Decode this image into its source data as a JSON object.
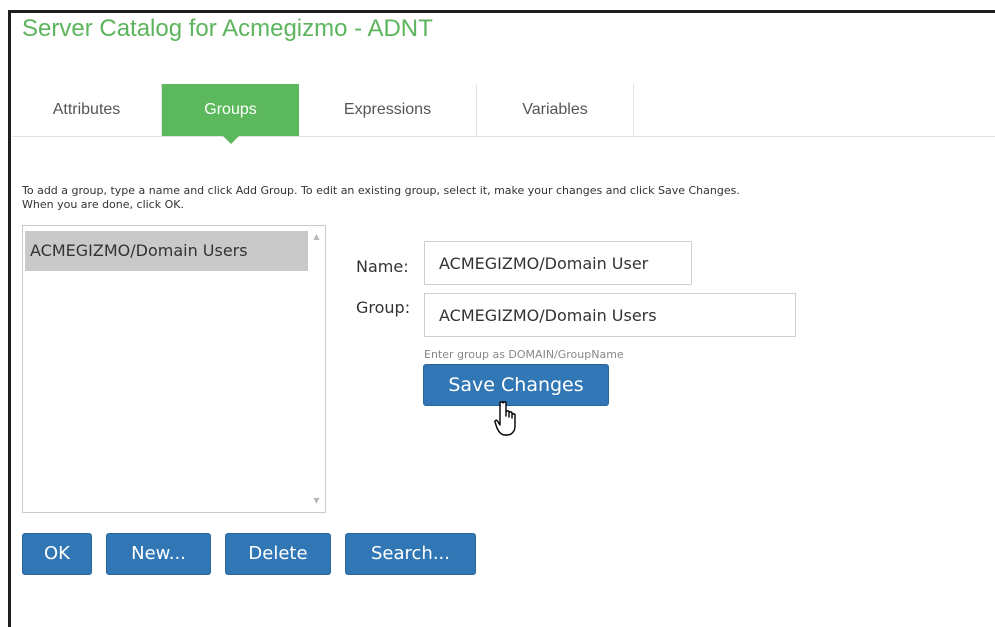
{
  "window": {
    "title": "Server Catalog for Acmegizmo - ADNT"
  },
  "tabs": [
    {
      "label": "Attributes",
      "active": false
    },
    {
      "label": "Groups",
      "active": true
    },
    {
      "label": "Expressions",
      "active": false
    },
    {
      "label": "Variables",
      "active": false
    }
  ],
  "instructions": {
    "line1": "To add a group, type a name and click Add Group. To edit an existing group, select it, make your changes and click Save Changes.",
    "line2": "When you are done, click OK."
  },
  "group_list": {
    "items": [
      {
        "label": "ACMEGIZMO/Domain Users",
        "selected": true
      }
    ]
  },
  "form": {
    "name_label": "Name:",
    "name_value": "ACMEGIZMO/Domain User",
    "group_label": "Group:",
    "group_value": "ACMEGIZMO/Domain Users",
    "group_help": "Enter group as DOMAIN/GroupName",
    "save_label": "Save Changes"
  },
  "actions": {
    "ok_label": "OK",
    "new_label": "New...",
    "delete_label": "Delete",
    "search_label": "Search..."
  },
  "colors": {
    "title_green": "#5cb55c",
    "tab_active_green": "#5cb85c",
    "button_blue": "#3277b5",
    "selection_gray": "#c9c9c9"
  },
  "icons": {
    "cursor": "hand-pointer-icon",
    "scroll_up": "triangle-up-icon",
    "scroll_down": "triangle-down-icon"
  }
}
